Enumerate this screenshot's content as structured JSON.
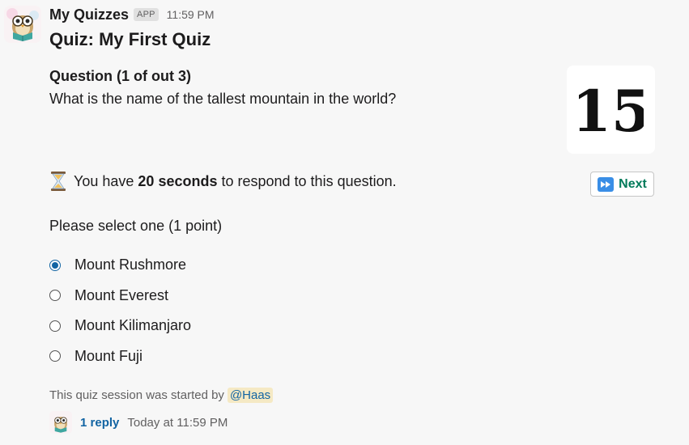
{
  "message": {
    "app_name": "My Quizzes",
    "app_badge": "APP",
    "timestamp": "11:59 PM",
    "avatar_icon": "owl-reading-book-icon"
  },
  "quiz": {
    "title": "Quiz: My First Quiz",
    "question_heading": "Question (1 of out 3)",
    "question_text": "What is the name of the tallest mountain in the world?",
    "number_image_text": "15",
    "timer_prefix": "You have ",
    "timer_bold": "20 seconds",
    "timer_suffix": " to respond to this question.",
    "timer_icon": "hourglass-icon",
    "next_button_label": "Next",
    "next_button_icon": "fast-forward-icon",
    "prompt": "Please select one (1 point)",
    "options": [
      {
        "label": "Mount Rushmore",
        "selected": true
      },
      {
        "label": "Mount Everest",
        "selected": false
      },
      {
        "label": "Mount Kilimanjaro",
        "selected": false
      },
      {
        "label": "Mount Fuji",
        "selected": false
      }
    ]
  },
  "footer": {
    "session_text": "This quiz session was started by",
    "mention": "@Haas",
    "reply_count": "1 reply",
    "reply_time": "Today at 11:59 PM"
  },
  "colors": {
    "background": "#f7f7f7",
    "link": "#1264a3",
    "next_text": "#007a5a",
    "mention_bg": "#f5e9c4"
  }
}
